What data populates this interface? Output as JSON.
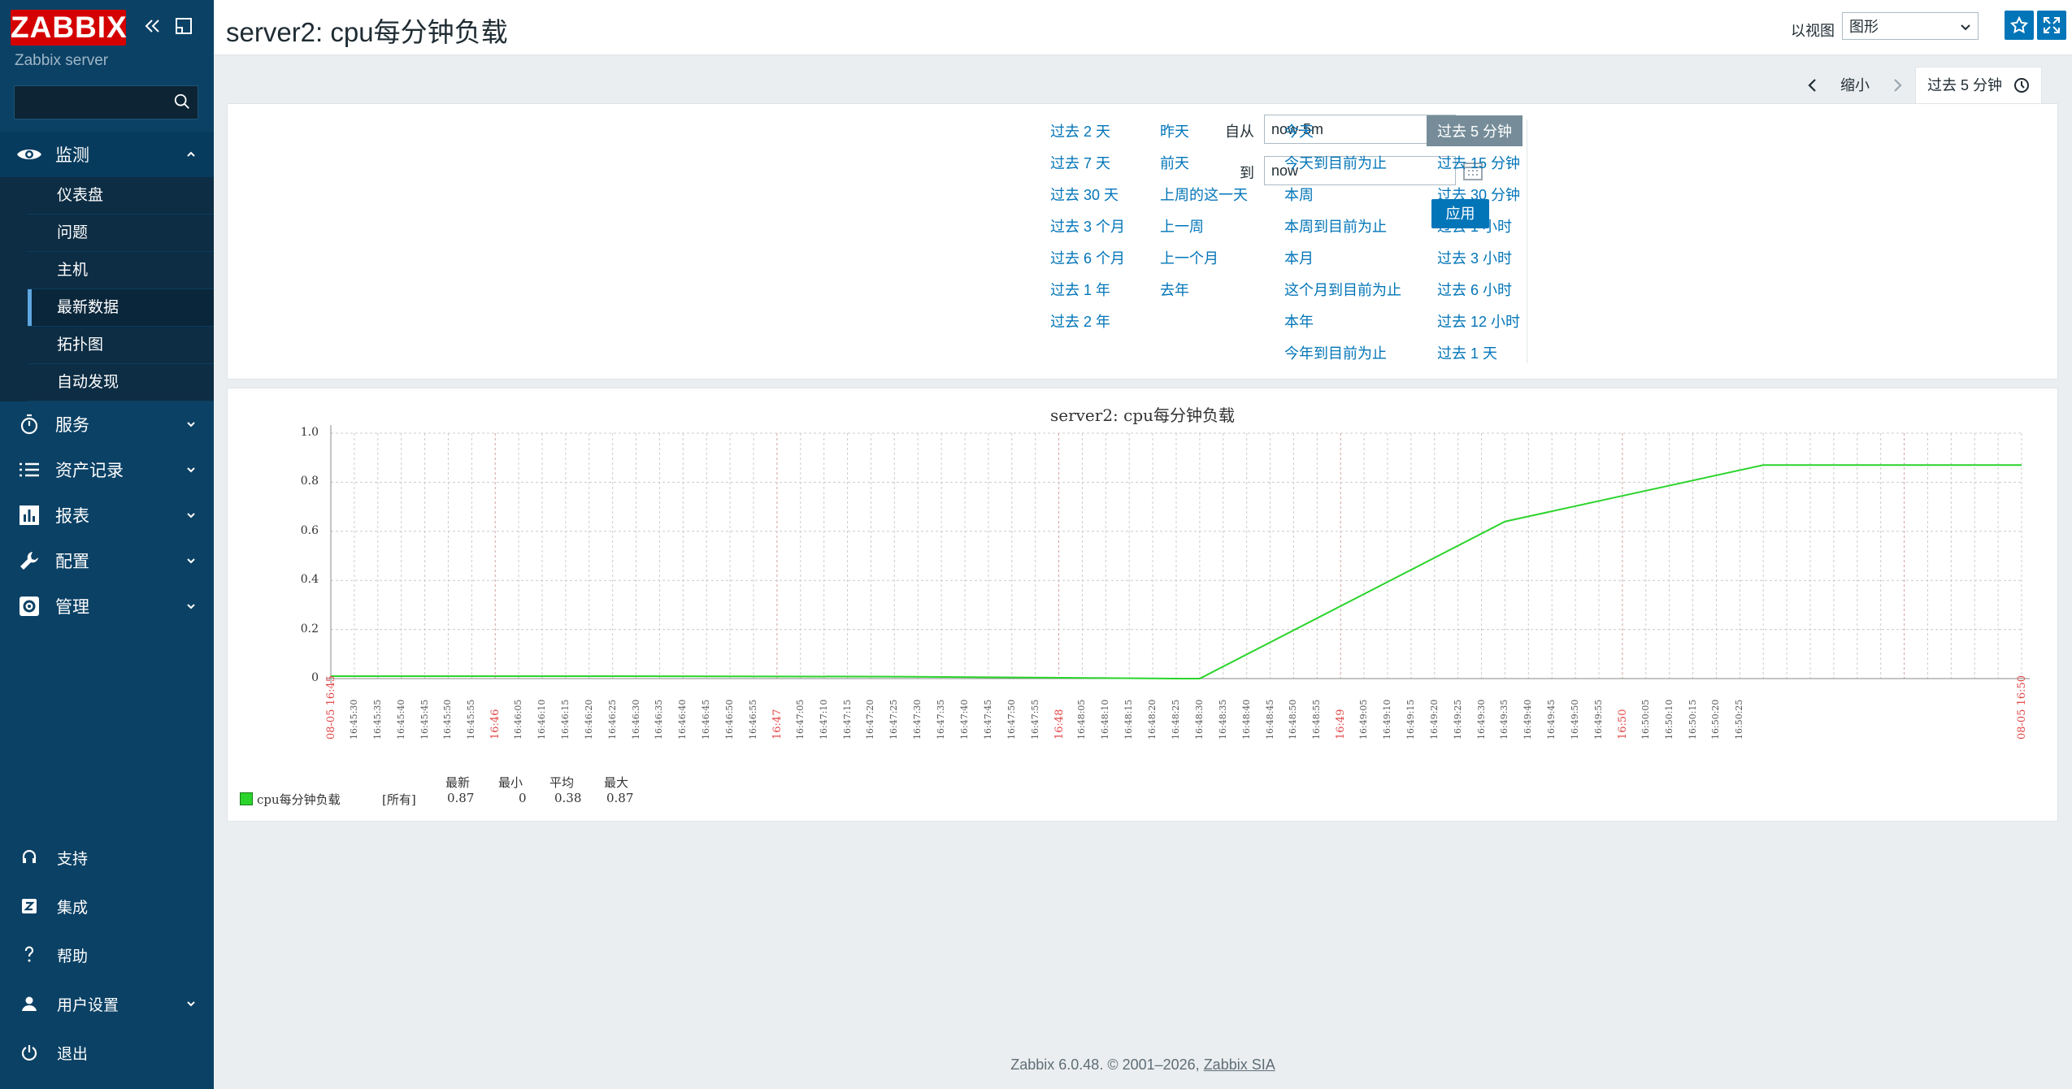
{
  "sidebar": {
    "logo": "ZABBIX",
    "server_name": "Zabbix server",
    "search_placeholder": "",
    "menu": [
      {
        "label": "监测",
        "icon": "eye-icon",
        "open": true,
        "items": [
          {
            "label": "仪表盘"
          },
          {
            "label": "问题"
          },
          {
            "label": "主机"
          },
          {
            "label": "最新数据",
            "active": true
          },
          {
            "label": "拓扑图"
          },
          {
            "label": "自动发现"
          }
        ]
      },
      {
        "label": "服务",
        "icon": "stopwatch-icon"
      },
      {
        "label": "资产记录",
        "icon": "list-icon"
      },
      {
        "label": "报表",
        "icon": "bar-chart-icon"
      },
      {
        "label": "配置",
        "icon": "wrench-icon"
      },
      {
        "label": "管理",
        "icon": "gear-icon"
      }
    ],
    "footer": [
      {
        "label": "支持",
        "icon": "headset-icon"
      },
      {
        "label": "集成",
        "icon": "zabbix-z-icon"
      },
      {
        "label": "帮助",
        "icon": "question-icon"
      },
      {
        "label": "用户设置",
        "icon": "user-icon"
      },
      {
        "label": "退出",
        "icon": "power-icon"
      }
    ]
  },
  "header": {
    "title": "server2: cpu每分钟负载",
    "view_label": "以视图",
    "view_value": "图形"
  },
  "time_tabs": {
    "zoom_out": "缩小",
    "selected": "过去 5 分钟"
  },
  "filter": {
    "from_label": "自从",
    "from_value": "now-5m",
    "to_label": "到",
    "to_value": "now",
    "apply": "应用",
    "quick": [
      [
        "过去 2 天",
        "过去 7 天",
        "过去 30 天",
        "过去 3 个月",
        "过去 6 个月",
        "过去 1 年",
        "过去 2 年"
      ],
      [
        "昨天",
        "前天",
        "上周的这一天",
        "上一周",
        "上一个月",
        "去年"
      ],
      [
        "今天",
        "今天到目前为止",
        "本周",
        "本周到目前为止",
        "本月",
        "这个月到目前为止",
        "本年",
        "今年到目前为止"
      ],
      [
        "过去 5 分钟",
        "过去 15 分钟",
        "过去 30 分钟",
        "过去 1 小时",
        "过去 3 小时",
        "过去 6 小时",
        "过去 12 小时",
        "过去 1 天"
      ]
    ],
    "quick_selected": "过去 5 分钟"
  },
  "chart_data": {
    "type": "line",
    "title": "server2: cpu每分钟负载",
    "ylim": [
      0,
      1.0
    ],
    "yticks": [
      "1.0",
      "0.8",
      "0.6",
      "0.4",
      "0.2",
      "0"
    ],
    "x_start_label": "08-05 16:45",
    "x_end_label": "08-05 16:50",
    "x_minor_labels": [
      "16:45:30",
      "16:45:35",
      "16:45:40",
      "16:45:45",
      "16:45:50",
      "16:45:55",
      "16:46",
      "16:46:05",
      "16:46:10",
      "16:46:15",
      "16:46:20",
      "16:46:25",
      "16:46:30",
      "16:46:35",
      "16:46:40",
      "16:46:45",
      "16:46:50",
      "16:46:55",
      "16:47",
      "16:47:05",
      "16:47:10",
      "16:47:15",
      "16:47:20",
      "16:47:25",
      "16:47:30",
      "16:47:35",
      "16:47:40",
      "16:47:45",
      "16:47:50",
      "16:47:55",
      "16:48",
      "16:48:05",
      "16:48:10",
      "16:48:15",
      "16:48:20",
      "16:48:25",
      "16:48:30",
      "16:48:35",
      "16:48:40",
      "16:48:45",
      "16:48:50",
      "16:48:55",
      "16:49",
      "16:49:05",
      "16:49:10",
      "16:49:15",
      "16:49:20",
      "16:49:25",
      "16:49:30",
      "16:49:35",
      "16:49:40",
      "16:49:45",
      "16:49:50",
      "16:49:55",
      "16:50",
      "16:50:05",
      "16:50:10",
      "16:50:15",
      "16:50:20",
      "16:50:25"
    ],
    "series": [
      {
        "name": "cpu每分钟负载",
        "color": "#2bd42b",
        "x_seconds": [
          0,
          15,
          60,
          120,
          180,
          185,
          250,
          305,
          360
        ],
        "x": [
          "16:45:25",
          "16:45:40",
          "16:46:25",
          "16:47:25",
          "16:48:25",
          "16:48:30",
          "16:49:35",
          "16:50:30",
          "16:51:25"
        ],
        "values": [
          0.01,
          0.01,
          0.01,
          0.008,
          0.0,
          0.0,
          0.64,
          0.87,
          0.87
        ]
      }
    ],
    "legend": {
      "headers": [
        "最新",
        "最小",
        "平均",
        "最大"
      ],
      "name": "cpu每分钟负载",
      "scope": "[所有]",
      "latest": "0.87",
      "min": "0",
      "avg": "0.38",
      "max": "0.87"
    }
  },
  "footer": {
    "text": "Zabbix 6.0.48. © 2001–2026, ",
    "link": "Zabbix SIA"
  }
}
